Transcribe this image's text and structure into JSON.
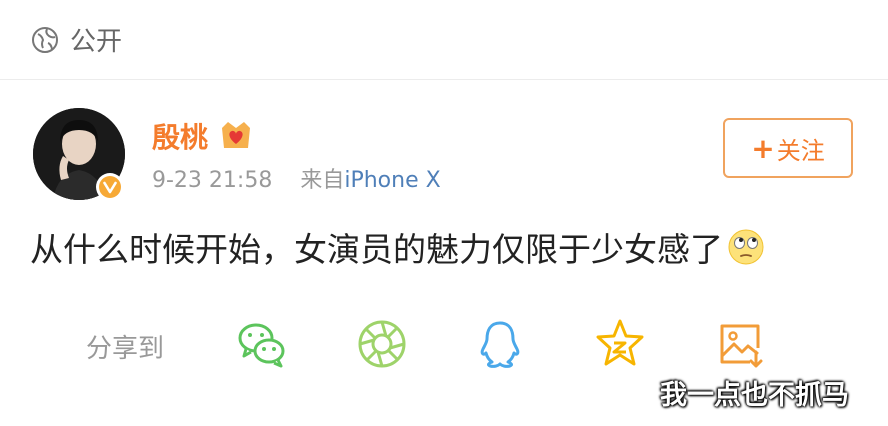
{
  "visibility": {
    "label": "公开",
    "icon": "globe-icon"
  },
  "post": {
    "user_name": "殷桃",
    "vip_icon": "crown-heart-icon",
    "verified_icon": "verified-badge-icon",
    "timestamp": "9-23 21:58",
    "source_prefix": "来自",
    "source": "iPhone X",
    "follow_label": "关注",
    "text": "从什么时候开始，女演员的魅力仅限于少女感了",
    "emoji": "eye-roll-emoji"
  },
  "share": {
    "label": "分享到",
    "targets": [
      "wechat-icon",
      "moments-icon",
      "qq-icon",
      "qzone-icon",
      "save-image-icon"
    ]
  },
  "watermark": "我一点也不抓马",
  "colors": {
    "accent": "#f47c2c",
    "link": "#4f7fb8",
    "muted": "#999999",
    "wechat": "#5cc45c",
    "moments": "#9ed36a",
    "qq": "#4aa8ea",
    "qzone": "#f7b500",
    "save": "#f29c38"
  }
}
